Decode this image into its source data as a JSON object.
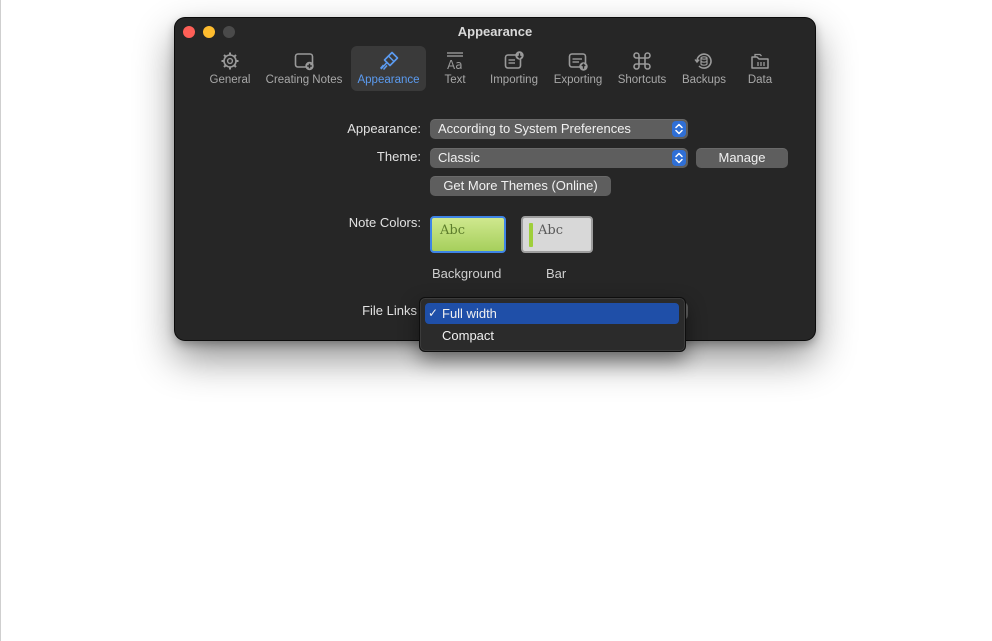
{
  "window": {
    "title": "Appearance"
  },
  "toolbar": {
    "items": [
      {
        "label": "General",
        "icon": "gear-icon"
      },
      {
        "label": "Creating Notes",
        "icon": "new-note-icon"
      },
      {
        "label": "Appearance",
        "icon": "brush-icon"
      },
      {
        "label": "Text",
        "icon": "text-format-icon"
      },
      {
        "label": "Importing",
        "icon": "import-icon"
      },
      {
        "label": "Exporting",
        "icon": "export-icon"
      },
      {
        "label": "Shortcuts",
        "icon": "command-icon"
      },
      {
        "label": "Backups",
        "icon": "backup-icon"
      },
      {
        "label": "Data",
        "icon": "data-folder-icon"
      }
    ],
    "active": "Appearance"
  },
  "form": {
    "appearance_label": "Appearance:",
    "appearance_value": "According to System Preferences",
    "theme_label": "Theme:",
    "theme_value": "Classic",
    "manage_label": "Manage",
    "more_themes_label": "Get More Themes (Online)",
    "note_colors_label": "Note Colors:",
    "swatch_text": "Abc",
    "background_caption": "Background",
    "bar_caption": "Bar",
    "file_links_label": "File Links"
  },
  "file_links_menu": {
    "options": [
      "Full width",
      "Compact"
    ],
    "selected": "Full width",
    "checkmark": "✓"
  },
  "colors": {
    "accent": "#5b9bf0",
    "menu_highlight": "#1f4fa8",
    "window_bg": "#262626"
  }
}
